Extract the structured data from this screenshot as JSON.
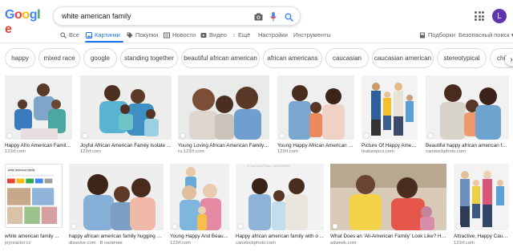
{
  "search": {
    "query": "white american family"
  },
  "header": {
    "avatar_letter": "L"
  },
  "tabs": [
    {
      "label": "Все",
      "icon": "search-icon"
    },
    {
      "label": "Картинки",
      "icon": "image-icon",
      "active": true
    },
    {
      "label": "Покупки",
      "icon": "tag-icon"
    },
    {
      "label": "Новости",
      "icon": "news-icon"
    },
    {
      "label": "Видео",
      "icon": "video-icon"
    },
    {
      "label": "Ещё",
      "icon": "more-vert-icon"
    },
    {
      "label": "Настройки"
    },
    {
      "label": "Инструменты"
    }
  ],
  "right_tabs": {
    "collections": "Подборки",
    "safe_search": "Безопасный поиск ▾"
  },
  "chips": [
    "happy",
    "mixed race",
    "google",
    "standing together",
    "beautiful african american",
    "african americans",
    "caucasian",
    "caucasian american",
    "stereotypical",
    "chil"
  ],
  "results": [
    {
      "title": "Happy Afro American Family ...",
      "source": "123rf.com"
    },
    {
      "title": "Joyful African American Family Isolate ...",
      "source": "123rf.com"
    },
    {
      "title": "Young Loving African American Family ...",
      "source": "ru.123rf.com"
    },
    {
      "title": "Young Happy African American F ...",
      "source": "123rf.com"
    },
    {
      "title": "Picture Of Happy Amer ...",
      "source": "featurepics.com"
    },
    {
      "title": "Beautiful happy african american fa ...",
      "source": "canstockphoto.com"
    },
    {
      "title": "white american family ...",
      "source": "joyreactor.cc",
      "thumb_text": "white american family"
    },
    {
      "title": "happy african american family hugging a ...",
      "source": "dissolve.com · В наличии"
    },
    {
      "title": "Young Happy And Beaut ...",
      "source": "123rf.com"
    },
    {
      "title": "Happy african american family with o ...",
      "source": "canstockphoto.com",
      "thumb_text": "© Can Stock Photo - csp20295951"
    },
    {
      "title": "What Does an 'All-American Family' Look Like? HP ...",
      "source": "adweek.com"
    },
    {
      "title": "Attractive, Happy Cauc ...",
      "source": "123rf.com"
    }
  ],
  "colors": {
    "accent": "#1a73e8",
    "avatar": "#5e35b1"
  }
}
